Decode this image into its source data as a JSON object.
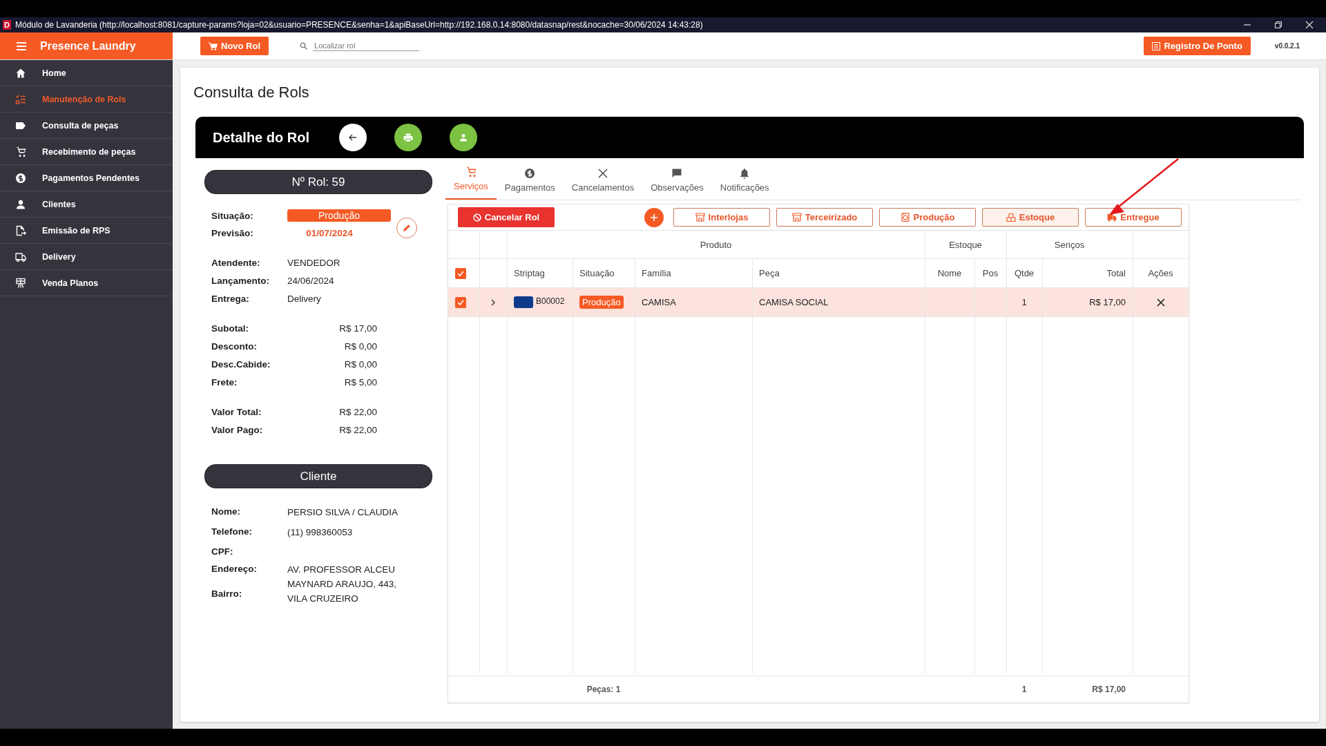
{
  "window": {
    "app_letter": "D",
    "title": "Módulo de Lavanderia (http://localhost:8081/capture-params?loja=02&usuario=PRESENCE&senha=1&apiBaseUrl=http://192.168.0.14:8080/datasnap/rest&nocache=30/06/2024 14:43:28)"
  },
  "header": {
    "brand": "Presence Laundry",
    "new_button": "Novo Rol",
    "search_placeholder": "Localizar rol",
    "clock_button": "Registro De Ponto",
    "version": "v0.0.2.1"
  },
  "sidebar": [
    {
      "kind": "home",
      "label": "Home",
      "selected": false
    },
    {
      "kind": "list",
      "label": "Manutenção de Rols",
      "selected": true
    },
    {
      "kind": "tag",
      "label": "Consulta de peças",
      "selected": false
    },
    {
      "kind": "cart",
      "label": "Recebimento de peças",
      "selected": false
    },
    {
      "kind": "money",
      "label": "Pagamentos Pendentes",
      "selected": false
    },
    {
      "kind": "person",
      "label": "Clientes",
      "selected": false
    },
    {
      "kind": "doc",
      "label": "Emissão de RPS",
      "selected": false
    },
    {
      "kind": "truck",
      "label": "Delivery",
      "selected": false
    },
    {
      "kind": "plan",
      "label": "Venda Planos",
      "selected": false
    }
  ],
  "page_title": "Consulta de Rols",
  "detail_title": "Detalhe do Rol",
  "rol_number": "Nº Rol: 59",
  "status": {
    "label": "Situação:",
    "value": "Produção"
  },
  "forecast": {
    "label": "Previsão:",
    "value": "01/07/2024"
  },
  "info": [
    {
      "label": "Atendente:",
      "value": "VENDEDOR"
    },
    {
      "label": "Lançamento:",
      "value": "24/06/2024"
    },
    {
      "label": "Entrega:",
      "value": "Delivery"
    }
  ],
  "amounts": [
    {
      "label": "Subotal:",
      "value": "R$ 17,00"
    },
    {
      "label": "Desconto:",
      "value": "R$ 0,00"
    },
    {
      "label": "Desc.Cabide:",
      "value": "R$ 0,00"
    },
    {
      "label": "Frete:",
      "value": "R$ 5,00"
    }
  ],
  "totals": [
    {
      "label": "Valor Total:",
      "value": "R$ 22,00"
    },
    {
      "label": "Valor Pago:",
      "value": "R$ 22,00"
    }
  ],
  "client_title": "Cliente",
  "client": [
    {
      "label": "Nome:",
      "value": "PERSIO SILVA / CLAUDIA"
    },
    {
      "label": "Telefone:",
      "value": "(11) 998360053"
    },
    {
      "label": "CPF:"
    },
    {
      "label": "Endereço:",
      "value": "AV. PROFESSOR ALCEU MAYNARD ARAUJO, 443, VILA CRUZEIRO"
    },
    {
      "label": "Bairro:"
    }
  ],
  "tabs": [
    {
      "kind": "cart",
      "label": "Serviços",
      "selected": true
    },
    {
      "kind": "money",
      "label": "Pagamentos",
      "selected": false
    },
    {
      "kind": "close",
      "label": "Cancelamentos",
      "selected": false
    },
    {
      "kind": "chat",
      "label": "Observações",
      "selected": false
    },
    {
      "kind": "bell",
      "label": "Notificações",
      "selected": false
    }
  ],
  "cancel_button": "Cancelar Rol",
  "status_buttons": [
    {
      "kind": "store",
      "label": "Interlojas"
    },
    {
      "kind": "store",
      "label": "Terceirizado"
    },
    {
      "kind": "washer",
      "label": "Produção"
    },
    {
      "kind": "boxes",
      "label": "Estoque"
    },
    {
      "kind": "truck",
      "label": "Entregue"
    }
  ],
  "table": {
    "groups": [
      "Produto",
      "Estoque",
      "Seriços"
    ],
    "columns": [
      "Striptag",
      "Situação",
      "Família",
      "Peça",
      "Nome",
      "Pos",
      "Qtde",
      "Total",
      "Ações"
    ],
    "all_checked": true,
    "rows": [
      {
        "checked": true,
        "color": "#0d3b8a",
        "striptag": "B00002",
        "status": "Produção",
        "family": "CAMISA",
        "piece": "CAMISA SOCIAL",
        "qty": "1",
        "total": "R$ 17,00"
      }
    ],
    "footer": {
      "pieces": "Peças: 1",
      "qty": "1",
      "total": "R$ 17,00"
    }
  }
}
